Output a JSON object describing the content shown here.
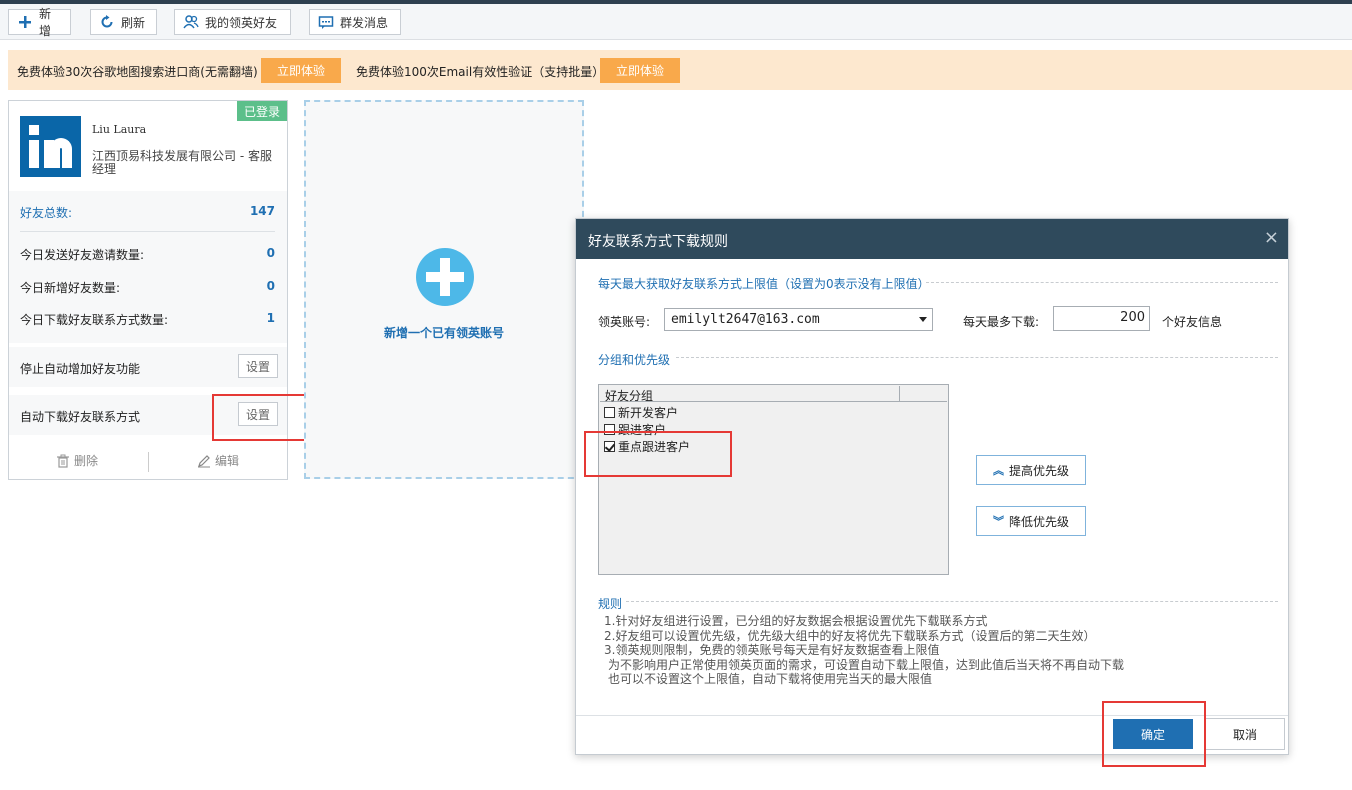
{
  "toolbar": {
    "add_label": "新增",
    "refresh_label": "刷新",
    "friends_label": "我的领英好友",
    "broadcast_label": "群发消息"
  },
  "promo": {
    "text1": "免费体验30次谷歌地图搜索进口商(无需翻墙)",
    "btn1": "立即体验",
    "text2": "免费体验100次Email有效性验证（支持批量）",
    "btn2": "立即体验"
  },
  "account_card": {
    "status": "已登录",
    "name": "Liu Laura",
    "company": "江西顶易科技发展有限公司 - 客服经理",
    "stats": [
      {
        "label": "好友总数:",
        "value": "147"
      },
      {
        "label": "今日发送好友邀请数量:",
        "value": "0"
      },
      {
        "label": "今日新增好友数量:",
        "value": "0"
      },
      {
        "label": "今日下载好友联系方式数量:",
        "value": "1"
      }
    ],
    "auto_add_label": "停止自动增加好友功能",
    "auto_download_label": "自动下载好友联系方式",
    "set_label": "设置",
    "delete_label": "删除",
    "edit_label": "编辑"
  },
  "add_account": {
    "label": "新增一个已有领英账号"
  },
  "dialog": {
    "title": "好友联系方式下载规则",
    "close": "×",
    "limit_section": "每天最大获取好友联系方式上限值（设置为0表示没有上限值）",
    "account_label": "领英账号:",
    "account_value": "emilylt2647@163.com",
    "daily_max_label": "每天最多下载:",
    "daily_max_value": "200",
    "unit_label": "个好友信息",
    "group_section": "分组和优先级",
    "list_header": "好友分组",
    "groups": [
      {
        "label": "新开发客户",
        "checked": false
      },
      {
        "label": "跟进客户",
        "checked": false
      },
      {
        "label": "重点跟进客户",
        "checked": true
      }
    ],
    "raise_label": "提高优先级",
    "lower_label": "降低优先级",
    "rules_section": "规则",
    "rules": [
      "1.针对好友组进行设置，已分组的好友数据会根据设置优先下载联系方式",
      "2.好友组可以设置优先级，优先级大组中的好友将优先下载联系方式（设置后的第二天生效）",
      "3.领英规则限制，免费的领英账号每天是有好友数据查看上限值",
      "  为不影响用户正常使用领英页面的需求，可设置自动下载上限值，达到此值后当天将不再自动下载",
      "  也可以不设置这个上限值，自动下载将使用完当天的最大限值"
    ],
    "ok_label": "确定",
    "cancel_label": "取消"
  },
  "colors": {
    "accent": "#1f6fb2",
    "promo_button": "#f9a94b",
    "highlight": "#e53935",
    "logged_in": "#5cbf8a"
  }
}
